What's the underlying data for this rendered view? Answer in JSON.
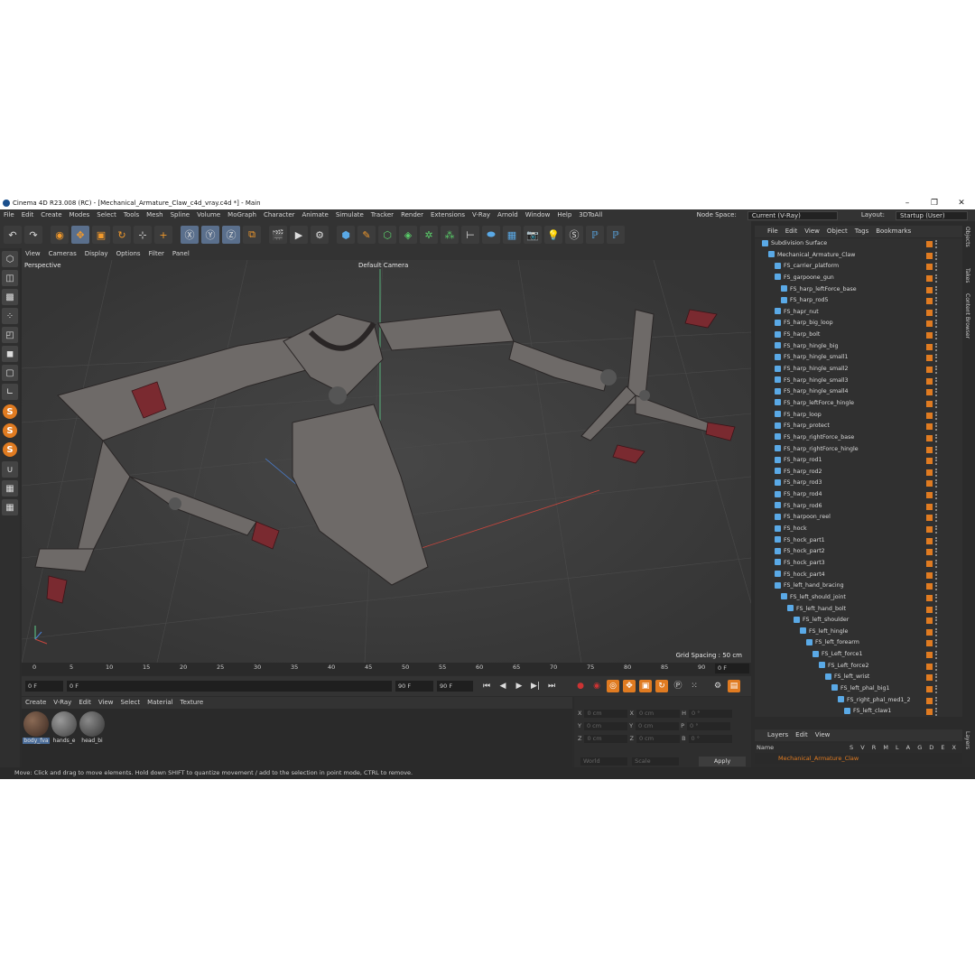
{
  "window": {
    "title": "Cinema 4D R23.008 (RC) - [Mechanical_Armature_Claw_c4d_vray.c4d *] - Main"
  },
  "menubar": {
    "items": [
      "File",
      "Edit",
      "Create",
      "Modes",
      "Select",
      "Tools",
      "Mesh",
      "Spline",
      "Volume",
      "MoGraph",
      "Character",
      "Animate",
      "Simulate",
      "Tracker",
      "Render",
      "Extensions",
      "V-Ray",
      "Arnold",
      "Window",
      "Help",
      "3DToAll"
    ],
    "node_space_label": "Node Space:",
    "node_space_value": "Current (V-Ray)",
    "layout_label": "Layout:",
    "layout_value": "Startup (User)"
  },
  "viewport": {
    "menu": [
      "View",
      "Cameras",
      "Display",
      "Options",
      "Filter",
      "Panel"
    ],
    "view_name": "Perspective",
    "camera": "Default Camera",
    "grid_spacing": "Grid Spacing : 50 cm"
  },
  "timeline": {
    "ticks": [
      "0",
      "5",
      "10",
      "15",
      "20",
      "25",
      "30",
      "35",
      "40",
      "45",
      "50",
      "55",
      "60",
      "65",
      "70",
      "75",
      "80",
      "85",
      "90"
    ],
    "current_frame": "0 F",
    "start": "0 F",
    "preview_start": "0 F",
    "preview_end": "90 F",
    "end": "90 F"
  },
  "materials": {
    "menu": [
      "Create",
      "V-Ray",
      "Edit",
      "View",
      "Select",
      "Material",
      "Texture"
    ],
    "items": [
      "body_fva",
      "hands_e",
      "head_bi"
    ]
  },
  "coordinates": {
    "rows": [
      {
        "a": "X",
        "av": "0 cm",
        "b": "X",
        "bv": "0 cm",
        "c": "H",
        "cv": "0 °"
      },
      {
        "a": "Y",
        "av": "0 cm",
        "b": "Y",
        "bv": "0 cm",
        "c": "P",
        "cv": "0 °"
      },
      {
        "a": "Z",
        "av": "0 cm",
        "b": "Z",
        "bv": "0 cm",
        "c": "B",
        "cv": "0 °"
      }
    ],
    "mode1": "World",
    "mode2": "Scale",
    "apply": "Apply"
  },
  "objects_panel": {
    "menu": [
      "File",
      "Edit",
      "View",
      "Object",
      "Tags",
      "Bookmarks"
    ],
    "items": [
      {
        "name": "Subdivision Surface",
        "indent": 0
      },
      {
        "name": "Mechanical_Armature_Claw",
        "indent": 1
      },
      {
        "name": "FS_carrier_platform",
        "indent": 2
      },
      {
        "name": "FS_garpoone_gun",
        "indent": 2
      },
      {
        "name": "FS_harp_leftForce_base",
        "indent": 3
      },
      {
        "name": "FS_harp_rod5",
        "indent": 3
      },
      {
        "name": "FS_hapr_nut",
        "indent": 2
      },
      {
        "name": "FS_harp_big_loop",
        "indent": 2
      },
      {
        "name": "FS_harp_bolt",
        "indent": 2
      },
      {
        "name": "FS_harp_hingle_big",
        "indent": 2
      },
      {
        "name": "FS_harp_hingle_small1",
        "indent": 2
      },
      {
        "name": "FS_harp_hingle_small2",
        "indent": 2
      },
      {
        "name": "FS_harp_hingle_small3",
        "indent": 2
      },
      {
        "name": "FS_harp_hingle_small4",
        "indent": 2
      },
      {
        "name": "FS_harp_leftForce_hingle",
        "indent": 2
      },
      {
        "name": "FS_harp_loop",
        "indent": 2
      },
      {
        "name": "FS_harp_protect",
        "indent": 2
      },
      {
        "name": "FS_harp_rightForce_base",
        "indent": 2
      },
      {
        "name": "FS_harp_rightForce_hingle",
        "indent": 2
      },
      {
        "name": "FS_harp_rod1",
        "indent": 2
      },
      {
        "name": "FS_harp_rod2",
        "indent": 2
      },
      {
        "name": "FS_harp_rod3",
        "indent": 2
      },
      {
        "name": "FS_harp_rod4",
        "indent": 2
      },
      {
        "name": "FS_harp_rod6",
        "indent": 2
      },
      {
        "name": "FS_harpoon_reel",
        "indent": 2
      },
      {
        "name": "FS_hock",
        "indent": 2
      },
      {
        "name": "FS_hock_part1",
        "indent": 2
      },
      {
        "name": "FS_hock_part2",
        "indent": 2
      },
      {
        "name": "FS_hock_part3",
        "indent": 2
      },
      {
        "name": "FS_hock_part4",
        "indent": 2
      },
      {
        "name": "FS_left_hand_bracing",
        "indent": 2
      },
      {
        "name": "FS_left_should_joint",
        "indent": 3
      },
      {
        "name": "FS_left_hand_bolt",
        "indent": 4
      },
      {
        "name": "FS_left_shoulder",
        "indent": 5
      },
      {
        "name": "FS_left_hingle",
        "indent": 6
      },
      {
        "name": "FS_left_forearm",
        "indent": 7
      },
      {
        "name": "FS_Left_force1",
        "indent": 8
      },
      {
        "name": "FS_Left_force2",
        "indent": 9
      },
      {
        "name": "FS_left_wrist",
        "indent": 10
      },
      {
        "name": "FS_left_phal_big1",
        "indent": 11
      },
      {
        "name": "FS_right_phal_med1_2",
        "indent": 12
      },
      {
        "name": "FS_left_claw1",
        "indent": 13
      }
    ]
  },
  "layers_panel": {
    "menu": [
      "Layers",
      "Edit",
      "View"
    ],
    "header": "Name",
    "columns": "S V R M L A G D E X",
    "layer": "Mechanical_Armature_Claw"
  },
  "side_tabs": [
    "Objects",
    "Takes",
    "Content Browser",
    "Layers"
  ],
  "status": "Move: Click and drag to move elements. Hold down SHIFT to quantize movement / add to the selection in point mode, CTRL to remove.",
  "colors": {
    "accent": "#e07b21",
    "selection": "#5a6f8c",
    "background": "#2b2b2b"
  }
}
